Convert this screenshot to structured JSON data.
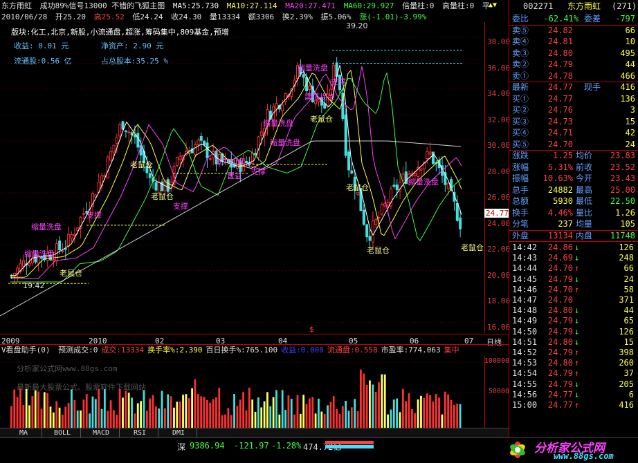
{
  "window": {
    "stock_name": "东方雨虹",
    "formula_title": "成功89%信号13000 不错的飞狐主图",
    "page_arrows": "▲▼"
  },
  "ma_line": {
    "ma5": "MA5:25.730",
    "ma10": "MA10:27.114",
    "ma20": "MA20:27.471",
    "ma60": "MA60:29.927",
    "bei": "倍量柱:0",
    "gao": "高量柱:0",
    "ping": "平"
  },
  "ohlc_line": {
    "date": "2010/06/28",
    "open": "开25.20",
    "high": "高25.52",
    "low": "低24.24",
    "close": "收24.30",
    "vol": "量13334",
    "amount": "额3306",
    "turnover": "换2.39%",
    "amplitude": "振5.06%",
    "change": "涨(-1.01)-3.99%"
  },
  "info": {
    "sector": "版块:化工,北京,新股,小流通盘,超涨,筹码集中,809基金,预增",
    "eps": "收益:   0.01 元",
    "nav": "净资产:   2.90 元",
    "float_shares": "流通股:0.56 亿",
    "ratio": "占总股本:35.25 %"
  },
  "price_axis": [
    "38.00",
    "36.00",
    "34.00",
    "32.00",
    "30.00",
    "28.00",
    "26.00",
    "24.00",
    "22.00",
    "20.00",
    "18.00",
    "16.00"
  ],
  "current_price_tag": "24.77",
  "annotations": {
    "high_mark": "39.20",
    "low_mark": "19.42",
    "s_mark": "$"
  },
  "chart_labels": [
    {
      "text": "老鼠仓",
      "color": "#ffff80"
    },
    {
      "text": "老鼠仓",
      "color": "#ffff80"
    },
    {
      "text": "老鼠仓",
      "color": "#ffff80"
    },
    {
      "text": "老鼠仓",
      "color": "#ffff80"
    },
    {
      "text": "老鼠仓",
      "color": "#ffff80"
    },
    {
      "text": "老鼠仓",
      "color": "#ffff80"
    },
    {
      "text": "老鼠仓",
      "color": "#ffff80"
    },
    {
      "text": "支撑",
      "color": "#ff40ff"
    },
    {
      "text": "支撑",
      "color": "#ff40ff"
    },
    {
      "text": "支撑",
      "color": "#ff40ff"
    },
    {
      "text": "支撑",
      "color": "#ff40ff"
    },
    {
      "text": "置益",
      "color": "#ff40ff"
    },
    {
      "text": "缩量洗盘",
      "color": "#ff40ff"
    },
    {
      "text": "缩量洗盘",
      "color": "#ff40ff"
    },
    {
      "text": "缩量洗盘",
      "color": "#ff40ff"
    },
    {
      "text": "缩量洗盘",
      "color": "#ff40ff"
    },
    {
      "text": "缩量洗盘",
      "color": "#ff40ff"
    },
    {
      "text": "震荡拐点",
      "color": "#ff40ff"
    },
    {
      "text": "主力加仓",
      "color": "#ff40ff"
    },
    {
      "text": "缩量洗盘",
      "color": "#ff40ff"
    }
  ],
  "date_axis": [
    "2009",
    "2010",
    "02",
    "03",
    "04",
    "05",
    "06",
    "07"
  ],
  "date_axis_right": "日线",
  "sub_chart": {
    "title": "V看盘助手(0)",
    "items": [
      {
        "text": "预测成交:0",
        "color": "#e0e0e0"
      },
      {
        "text": "成交:13334",
        "color": "#ff4040"
      },
      {
        "text": "换手率%:2.390",
        "color": "#ffff40"
      },
      {
        "text": "百日换手%:765.100",
        "color": "#e0e0e0"
      },
      {
        "text": "收益:0.008",
        "color": "#4040ff"
      },
      {
        "text": "流通盘:0.558",
        "color": "#ff4040"
      },
      {
        "text": "市盈率:774.063",
        "color": "#e0e0e0"
      },
      {
        "text": "集中",
        "color": "#ff4040"
      }
    ],
    "axis": [
      "100000",
      "50000"
    ],
    "watermarks": [
      "分析家公式网www.88gs.com",
      "最新最大股票公式、股票软件下载网站"
    ]
  },
  "tabs": [
    "MA",
    "BOLL",
    "MACD",
    "RSI",
    "DMI"
  ],
  "side": {
    "code": "002271",
    "name": "东方雨虹",
    "count": "(271)",
    "weibi": "委比",
    "weibi_val": "-62.41%",
    "weicha": "委差",
    "weicha_val": "-797",
    "sells": [
      {
        "label": "卖⑤",
        "price": "24.82",
        "vol": "66"
      },
      {
        "label": "卖④",
        "price": "24.81",
        "vol": "10"
      },
      {
        "label": "卖③",
        "price": "24.80",
        "vol": "495"
      },
      {
        "label": "卖②",
        "price": "24.79",
        "vol": "44"
      },
      {
        "label": "卖①",
        "price": "24.78",
        "vol": "466"
      }
    ],
    "latest": {
      "label": "最新",
      "price": "24.77",
      "label2": "现手",
      "vol": "416"
    },
    "buys": [
      {
        "label": "买①",
        "price": "24.77",
        "vol": "136"
      },
      {
        "label": "买②",
        "price": "24.76",
        "vol": "3"
      },
      {
        "label": "买③",
        "price": "24.73",
        "vol": "15"
      },
      {
        "label": "买④",
        "price": "24.71",
        "vol": "42"
      },
      {
        "label": "买⑤",
        "price": "24.70",
        "vol": "24"
      }
    ],
    "stats": [
      {
        "l1": "涨跌",
        "v1": "1.25",
        "l2": "均价",
        "v2": "23.83"
      },
      {
        "l1": "涨幅",
        "v1": "5.31%",
        "l2": "前收",
        "v2": "23.52"
      },
      {
        "l1": "振幅",
        "v1": "10.63%",
        "l2": "今开",
        "v2": "23.43"
      },
      {
        "l1": "总手",
        "v1": "24882",
        "l2": "最高",
        "v2": "25.00"
      },
      {
        "l1": "总额",
        "v1": "5930",
        "l2": "最低",
        "v2": "22.50"
      },
      {
        "l1": "换手",
        "v1": "4.46%",
        "l2": "量比",
        "v2": "1.26"
      },
      {
        "l1": "分笔",
        "v1": "237",
        "l2": "均量",
        "v2": "105"
      }
    ],
    "outer": {
      "l1": "外盘",
      "v1": "13134",
      "l2": "内盘",
      "v2": "11748"
    },
    "ticks": [
      {
        "t": "14:42",
        "p": "24.86",
        "d": "↓",
        "v": "126"
      },
      {
        "t": "14:43",
        "p": "24.69",
        "d": "↓",
        "v": "248"
      },
      {
        "t": "14:44",
        "p": "24.70",
        "d": "↑",
        "v": "66"
      },
      {
        "t": "14:45",
        "p": "24.79",
        "d": "↓",
        "v": "24"
      },
      {
        "t": "14:46",
        "p": "24.70",
        "d": "↑",
        "v": "58"
      },
      {
        "t": "14:47",
        "p": "24.70",
        "d": "",
        "v": "371"
      },
      {
        "t": "14:48",
        "p": "24.80",
        "d": "↓",
        "v": "44"
      },
      {
        "t": "14:49",
        "p": "24.79",
        "d": "↓",
        "v": "65"
      },
      {
        "t": "14:50",
        "p": "24.79",
        "d": "↓",
        "v": "126"
      },
      {
        "t": "14:51",
        "p": "24.80",
        "d": "↓",
        "v": "15"
      },
      {
        "t": "14:52",
        "p": "24.79",
        "d": "↑",
        "v": "398"
      },
      {
        "t": "14:53",
        "p": "24.80",
        "d": "↑",
        "v": "260"
      },
      {
        "t": "14:54",
        "p": "24.79",
        "d": "↑",
        "v": "37"
      },
      {
        "t": "14:55",
        "p": "24.79",
        "d": "↓",
        "v": "205"
      },
      {
        "t": "14:56",
        "p": "24.77",
        "d": "↓",
        "v": "6"
      },
      {
        "t": "15:00",
        "p": "24.77",
        "d": "↑",
        "v": "416"
      }
    ]
  },
  "status": {
    "market": "深",
    "index": "9386.94",
    "chg": "-121.97",
    "pct": "-1.28%",
    "amount": "474.72亿",
    "logo": "分析家公式网",
    "logo_url": "www.88gs.com"
  }
}
